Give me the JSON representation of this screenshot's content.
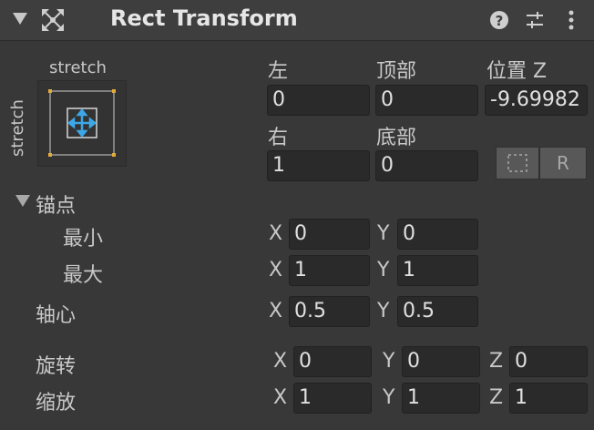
{
  "header": {
    "title": "Rect Transform"
  },
  "anchor_preset": {
    "horizontal": "stretch",
    "vertical": "stretch"
  },
  "position": {
    "left": {
      "label": "左",
      "value": "0"
    },
    "top": {
      "label": "顶部",
      "value": "0"
    },
    "pos_z": {
      "label": "位置 Z",
      "value": "-9.69982"
    },
    "right": {
      "label": "右",
      "value": "1"
    },
    "bottom": {
      "label": "底部",
      "value": "0"
    }
  },
  "buttons": {
    "raw_edit": "R"
  },
  "anchors": {
    "label": "锚点",
    "min": {
      "label": "最小",
      "x": "0",
      "y": "0"
    },
    "max": {
      "label": "最大",
      "x": "1",
      "y": "1"
    }
  },
  "pivot": {
    "label": "轴心",
    "x": "0.5",
    "y": "0.5"
  },
  "rotation": {
    "label": "旋转",
    "x": "0",
    "y": "0",
    "z": "0"
  },
  "scale": {
    "label": "缩放",
    "x": "1",
    "y": "1",
    "z": "1"
  },
  "axes": {
    "x": "X",
    "y": "Y",
    "z": "Z"
  }
}
